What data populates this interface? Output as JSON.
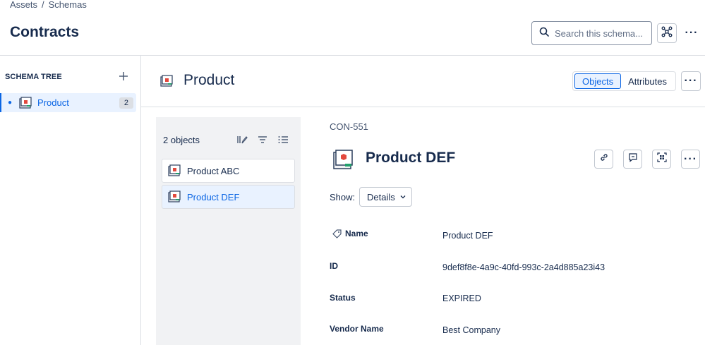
{
  "breadcrumb": {
    "root": "Assets",
    "separator": "/",
    "current": "Schemas"
  },
  "page": {
    "title": "Contracts"
  },
  "search": {
    "placeholder": "Search this schema..."
  },
  "header_icons": {
    "graph": "graph-view-icon",
    "more": "more-icon"
  },
  "sidebar": {
    "heading": "SCHEMA TREE",
    "add_icon": "plus-icon",
    "items": [
      {
        "label": "Product",
        "count": "2",
        "icon": "object-type-icon"
      }
    ]
  },
  "main": {
    "title": "Product",
    "tabs": [
      {
        "label": "Objects",
        "active": true
      },
      {
        "label": "Attributes",
        "active": false
      }
    ]
  },
  "objects_panel": {
    "count_label": "2 objects",
    "icons": [
      "edit-columns-icon",
      "filter-icon",
      "list-view-icon"
    ],
    "items": [
      {
        "label": "Product ABC",
        "selected": false
      },
      {
        "label": "Product DEF",
        "selected": true
      }
    ]
  },
  "detail": {
    "key": "CON-551",
    "title": "Product DEF",
    "actions": [
      "link-icon",
      "comment-icon",
      "qr-code-icon",
      "more-icon"
    ],
    "show_label": "Show:",
    "show_value": "Details",
    "attributes": [
      {
        "name": "Name",
        "value": "Product DEF"
      },
      {
        "name": "ID",
        "value": "9def8f8e-4a9c-40fd-993c-2a4d885a23i43"
      },
      {
        "name": "Status",
        "value": "EXPIRED"
      },
      {
        "name": "Vendor Name",
        "value": "Best Company"
      }
    ]
  },
  "colors": {
    "accent": "#0c66e4",
    "selected_bg": "#e9f2ff",
    "text": "#172b4d",
    "panel_bg": "#f1f2f4"
  }
}
